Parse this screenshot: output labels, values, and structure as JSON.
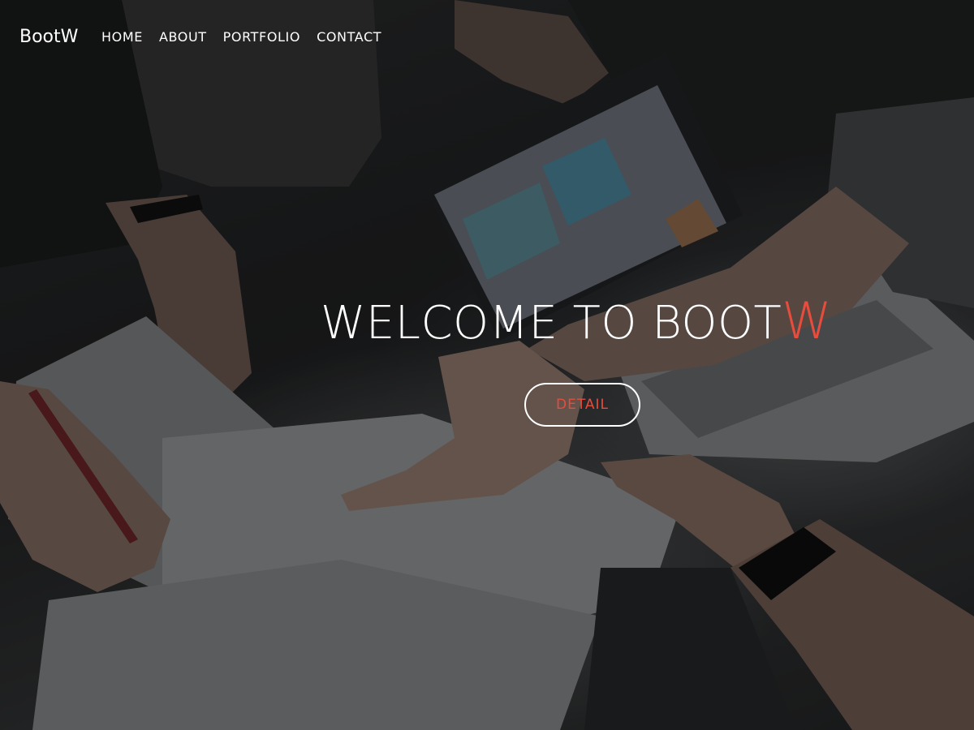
{
  "nav": {
    "brand": "BootW",
    "links": [
      "HOME",
      "ABOUT",
      "PORTFOLIO",
      "CONTACT"
    ]
  },
  "hero": {
    "title_main": "WELCOME TO BOOT",
    "title_accent": "W",
    "button_label": "DETAIL",
    "background_image": "desk-meeting-laptop-photo"
  },
  "colors": {
    "accent": "#e84c3d",
    "text": "#ffffff",
    "overlay": "#1b1c1d"
  }
}
